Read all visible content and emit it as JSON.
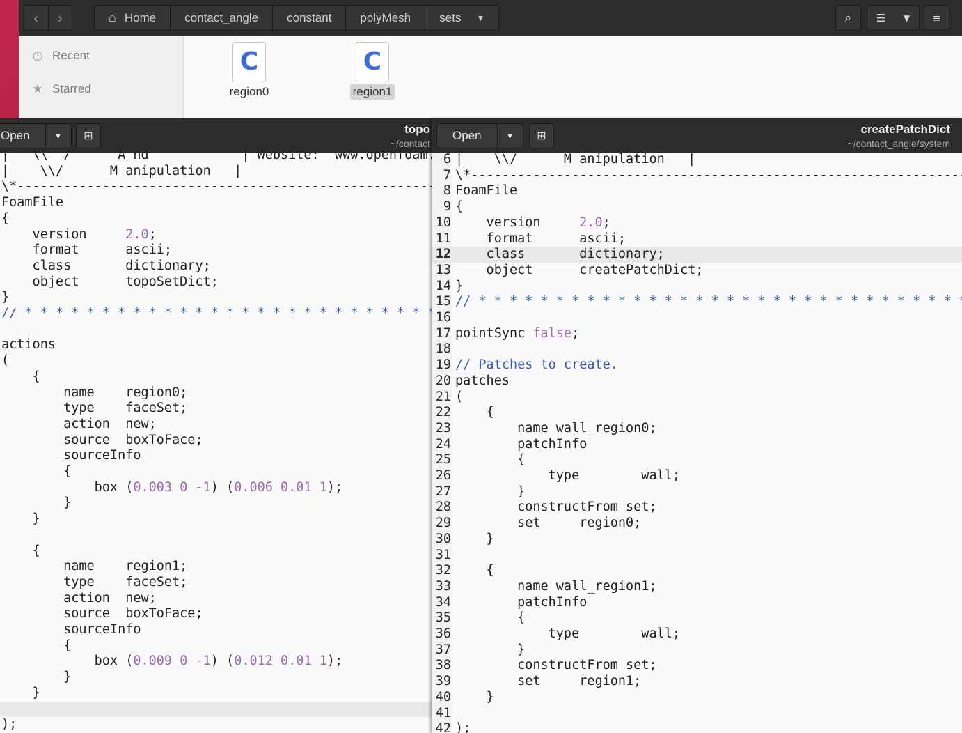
{
  "file_manager": {
    "path": [
      "Home",
      "contact_angle",
      "constant",
      "polyMesh",
      "sets"
    ],
    "sidebar": [
      {
        "label": "Recent",
        "icon": "clock-icon"
      },
      {
        "label": "Starred",
        "icon": "star-icon"
      }
    ],
    "files": [
      {
        "name": "region0",
        "icon": "c-source-file-icon",
        "selected": false
      },
      {
        "name": "region1",
        "icon": "c-source-file-icon",
        "selected": true
      }
    ]
  },
  "left_editor": {
    "open_label": "Open",
    "title": "topo",
    "subtitle": "~/contact",
    "lines": [
      "|   \\\\  /      A nd            | Website:  www.openfoam.com",
      "|    \\\\/      M anipulation   |",
      "\\*---------------------------------------------------------------------------*/",
      "FoamFile",
      "{",
      "    version     2.0;",
      "    format      ascii;",
      "    class       dictionary;",
      "    object      topoSetDict;",
      "}",
      "// * * * * * * * * * * * * * * * * * * * * * * * * * * * * * * * * * * //",
      "",
      "actions",
      "(",
      "    {",
      "        name    region0;",
      "        type    faceSet;",
      "        action  new;",
      "        source  boxToFace;",
      "        sourceInfo",
      "        {",
      "            box (0.003 0 -1) (0.006 0.01 1);",
      "        }",
      "    }",
      "",
      "    {",
      "        name    region1;",
      "        type    faceSet;",
      "        action  new;",
      "        source  boxToFace;",
      "        sourceInfo",
      "        {",
      "            box (0.009 0 -1) (0.012 0.01 1);",
      "        }",
      "    }",
      "",
      ");"
    ]
  },
  "right_editor": {
    "open_label": "Open",
    "title": "createPatchDict",
    "subtitle": "~/contact_angle/system",
    "current_line": 12,
    "lines": [
      {
        "n": "6",
        "text": "|    \\\\/      M anipulation   |"
      },
      {
        "n": "7",
        "text": "\\*---------------------------------------------------------------------------*/"
      },
      {
        "n": "8",
        "text": "FoamFile"
      },
      {
        "n": "9",
        "text": "{"
      },
      {
        "n": "10",
        "text": "    version     2.0;"
      },
      {
        "n": "11",
        "text": "    format      ascii;"
      },
      {
        "n": "12",
        "text": "    class       dictionary;"
      },
      {
        "n": "13",
        "text": "    object      createPatchDict;"
      },
      {
        "n": "14",
        "text": "}"
      },
      {
        "n": "15",
        "text": "// * * * * * * * * * * * * * * * * * * * * * * * * * * * * * * * * * * //"
      },
      {
        "n": "16",
        "text": ""
      },
      {
        "n": "17",
        "text": "pointSync false;"
      },
      {
        "n": "18",
        "text": ""
      },
      {
        "n": "19",
        "text": "// Patches to create."
      },
      {
        "n": "20",
        "text": "patches"
      },
      {
        "n": "21",
        "text": "("
      },
      {
        "n": "22",
        "text": "    {"
      },
      {
        "n": "23",
        "text": "        name wall_region0;"
      },
      {
        "n": "24",
        "text": "        patchInfo"
      },
      {
        "n": "25",
        "text": "        {"
      },
      {
        "n": "26",
        "text": "            type        wall;"
      },
      {
        "n": "27",
        "text": "        }"
      },
      {
        "n": "28",
        "text": "        constructFrom set;"
      },
      {
        "n": "29",
        "text": "        set     region0;"
      },
      {
        "n": "30",
        "text": "    }"
      },
      {
        "n": "31",
        "text": ""
      },
      {
        "n": "32",
        "text": "    {"
      },
      {
        "n": "33",
        "text": "        name wall_region1;"
      },
      {
        "n": "34",
        "text": "        patchInfo"
      },
      {
        "n": "35",
        "text": "        {"
      },
      {
        "n": "36",
        "text": "            type        wall;"
      },
      {
        "n": "37",
        "text": "        }"
      },
      {
        "n": "38",
        "text": "        constructFrom set;"
      },
      {
        "n": "39",
        "text": "        set     region1;"
      },
      {
        "n": "40",
        "text": "    }"
      },
      {
        "n": "41",
        "text": ""
      },
      {
        "n": "42",
        "text": ");"
      }
    ]
  }
}
